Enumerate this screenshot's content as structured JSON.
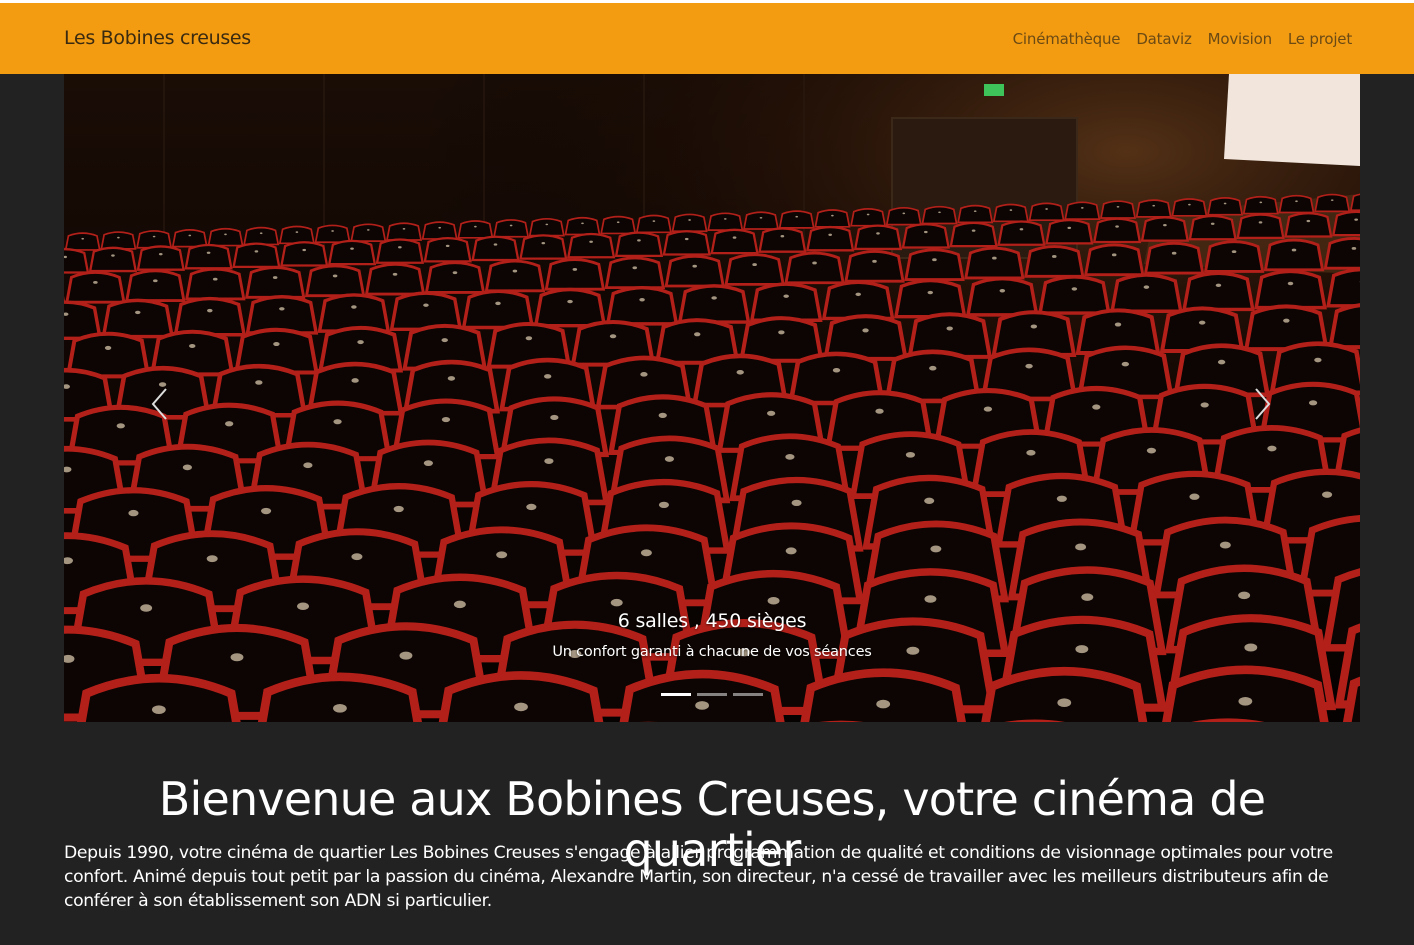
{
  "navbar": {
    "brand": "Les Bobines creuses",
    "items": [
      {
        "label": "Cinémathèque"
      },
      {
        "label": "Dataviz"
      },
      {
        "label": "Movision"
      },
      {
        "label": "Le projet"
      }
    ],
    "background": "#f39c12"
  },
  "carousel": {
    "caption_title": "6 salles , 450 sièges",
    "caption_text": "Un confort garanti à chacune de vos séances",
    "slide_count": 3,
    "active_slide": 1,
    "prev_icon": "chevron-left-icon",
    "next_icon": "chevron-right-icon"
  },
  "main": {
    "title": "Bienvenue aux Bobines Creuses, votre cinéma de quartier",
    "intro": "Depuis 1990, votre cinéma de quartier Les Bobines Creuses s'engage à allier programmation de qualité et conditions de visionnage optimales pour votre confort. Animé depuis tout petit par la passion du cinéma, Alexandre Martin, son directeur, n'a cessé de travailler avec les meilleurs distributeurs afin de conférer à son établissement son ADN si particulier."
  },
  "theme": {
    "page_background": "#222222",
    "seat_red": "#b3201a"
  }
}
